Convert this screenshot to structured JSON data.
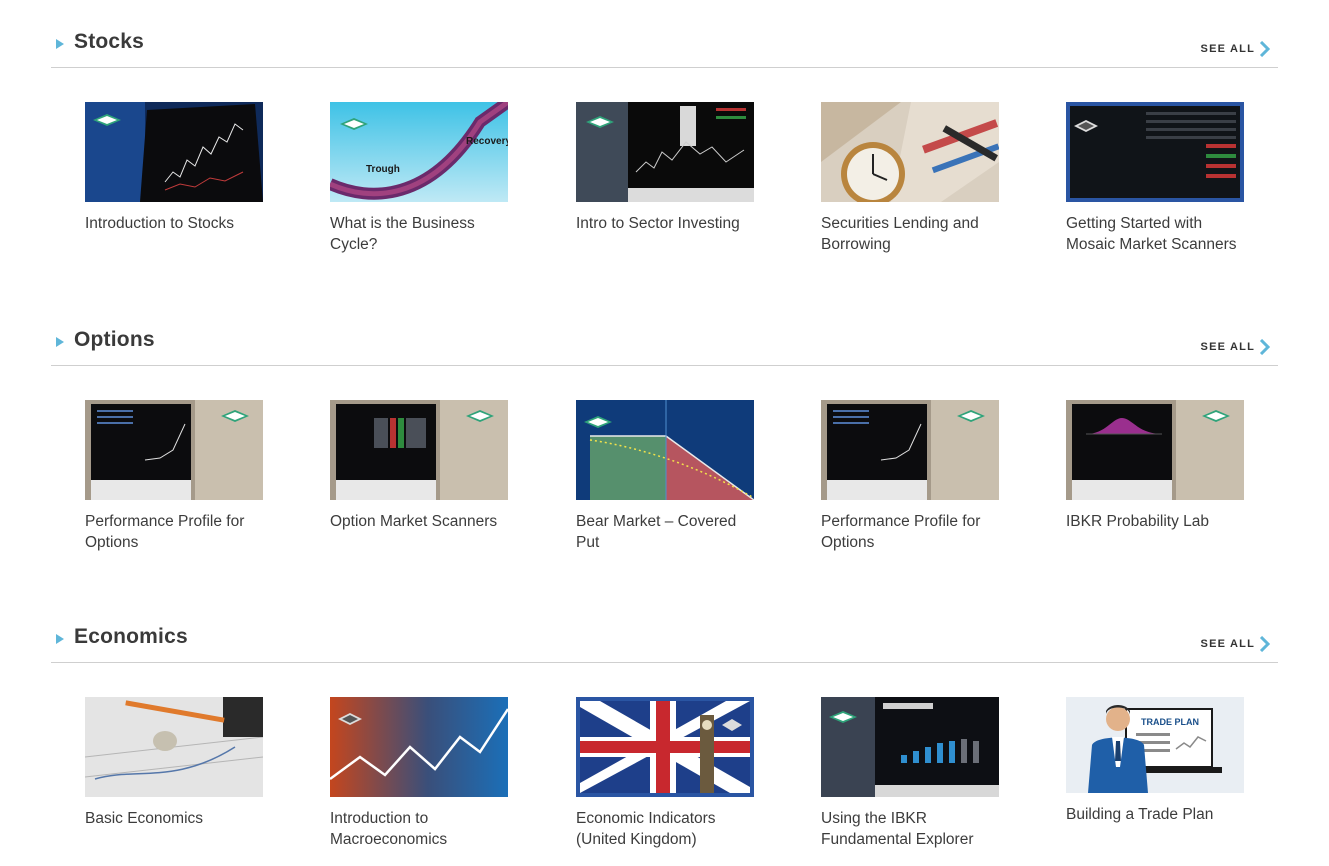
{
  "see_all_label": "SEE ALL",
  "accent_color": "#5fb6d9",
  "sections": [
    {
      "title": "Stocks",
      "cards": [
        {
          "title": "Introduction to Stocks",
          "thumb": "trading-chart-screen"
        },
        {
          "title": "What is the Business Cycle?",
          "thumb": "business-cycle-curve",
          "labels": [
            "Recovery",
            "Trough"
          ]
        },
        {
          "title": "Intro to Sector Investing",
          "thumb": "sector-monitor"
        },
        {
          "title": "Securities Lending and Borrowing",
          "thumb": "pocket-watch-pen"
        },
        {
          "title": "Getting Started with Mosaic Market Scanners",
          "thumb": "mosaic-scanner"
        }
      ]
    },
    {
      "title": "Options",
      "cards": [
        {
          "title": "Performance Profile for Options",
          "thumb": "options-monitor"
        },
        {
          "title": "Option Market Scanners",
          "thumb": "scanner-monitor"
        },
        {
          "title": "Bear Market – Covered Put",
          "thumb": "covered-put-chart"
        },
        {
          "title": "Performance Profile for Options",
          "thumb": "options-monitor"
        },
        {
          "title": "IBKR Probability Lab",
          "thumb": "probability-monitor"
        }
      ]
    },
    {
      "title": "Economics",
      "cards": [
        {
          "title": "Basic Economics",
          "thumb": "calculator-coin"
        },
        {
          "title": "Introduction to Macroeconomics",
          "thumb": "macro-line-chart"
        },
        {
          "title": "Economic Indicators (United Kingdom)",
          "thumb": "uk-flag-big-ben"
        },
        {
          "title": "Using the IBKR Fundamental Explorer",
          "thumb": "fundamental-explorer"
        },
        {
          "title": "Building a Trade Plan",
          "thumb": "trade-plan-illustration",
          "labels": [
            "TRADE PLAN"
          ]
        }
      ]
    }
  ]
}
